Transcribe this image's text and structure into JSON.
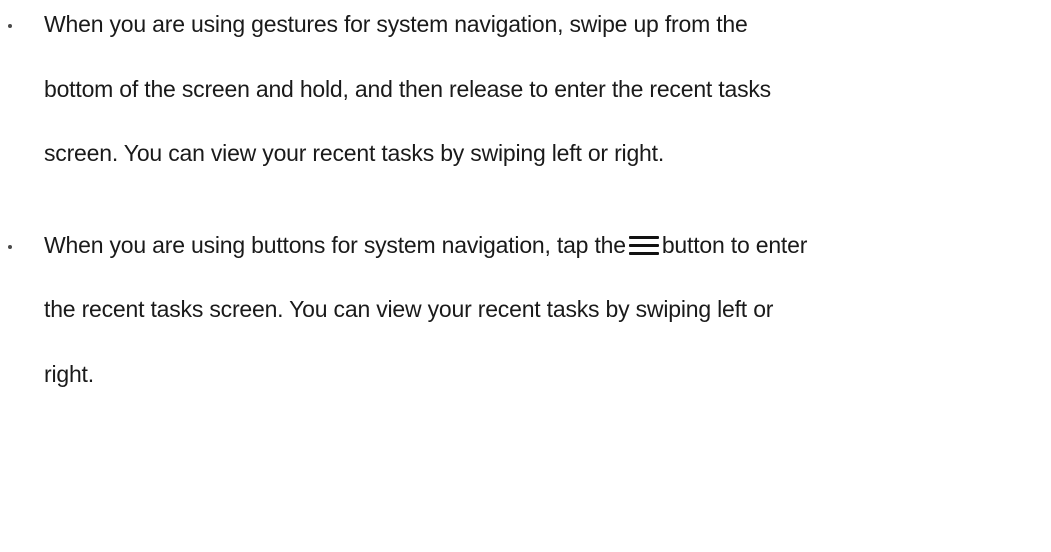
{
  "bullets": [
    {
      "lines": [
        "When you are using gestures for system navigation, swipe up from the",
        "bottom of the screen and hold, and then release to enter the recent tasks",
        "screen. You can view your recent tasks by swiping left or right."
      ]
    },
    {
      "line1_before_icon": "When you are using buttons for system navigation, tap the",
      "icon": "menu-icon",
      "line1_after_icon": "button to enter",
      "lines": [
        "the recent tasks screen. You can view your recent tasks by swiping left or",
        "right."
      ]
    }
  ]
}
